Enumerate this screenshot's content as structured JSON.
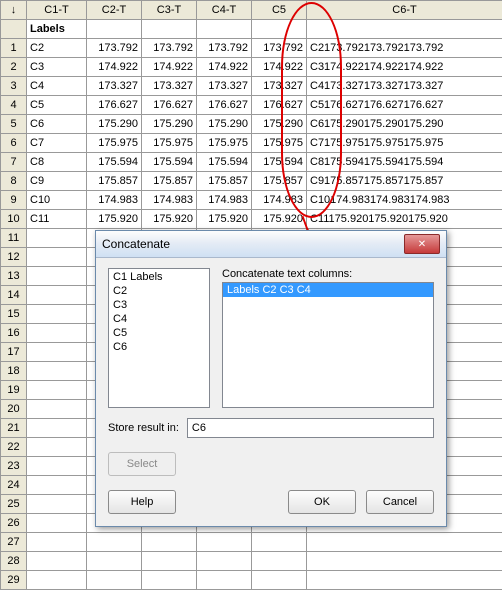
{
  "chart_data": {
    "type": "table",
    "columns": [
      "Labels",
      "C2-T",
      "C3-T",
      "C4-T",
      "C5",
      "C6-T"
    ],
    "rows": [
      [
        "C2",
        173.792,
        173.792,
        173.792,
        173.792,
        "C2173.792173.792173.792"
      ],
      [
        "C3",
        174.922,
        174.922,
        174.922,
        174.922,
        "C3174.922174.922174.922"
      ],
      [
        "C4",
        173.327,
        173.327,
        173.327,
        173.327,
        "C4173.327173.327173.327"
      ],
      [
        "C5",
        176.627,
        176.627,
        176.627,
        176.627,
        "C5176.627176.627176.627"
      ],
      [
        "C6",
        175.29,
        175.29,
        175.29,
        175.29,
        "C6175.290175.290175.290"
      ],
      [
        "C7",
        175.975,
        175.975,
        175.975,
        175.975,
        "C7175.975175.975175.975"
      ],
      [
        "C8",
        175.594,
        175.594,
        175.594,
        175.594,
        "C8175.594175.594175.594"
      ],
      [
        "C9",
        175.857,
        175.857,
        175.857,
        175.857,
        "C9175.857175.857175.857"
      ],
      [
        "C10",
        174.983,
        174.983,
        174.983,
        174.983,
        "C10174.983174.983174.983"
      ],
      [
        "C11",
        175.92,
        175.92,
        175.92,
        175.92,
        "C11175.920175.920175.920"
      ]
    ]
  },
  "headers": {
    "arrow": "↓",
    "c1": "C1-T",
    "c2": "C2-T",
    "c3": "C3-T",
    "c4": "C4-T",
    "c5": "C5",
    "c6": "C6-T",
    "sub": "Labels"
  },
  "rows": [
    {
      "n": "1",
      "l": "C2",
      "a": "173.792",
      "b": "173.792",
      "c": "173.792",
      "d": "173.792",
      "e": "C2173.792173.792173.792"
    },
    {
      "n": "2",
      "l": "C3",
      "a": "174.922",
      "b": "174.922",
      "c": "174.922",
      "d": "174.922",
      "e": "C3174.922174.922174.922"
    },
    {
      "n": "3",
      "l": "C4",
      "a": "173.327",
      "b": "173.327",
      "c": "173.327",
      "d": "173.327",
      "e": "C4173.327173.327173.327"
    },
    {
      "n": "4",
      "l": "C5",
      "a": "176.627",
      "b": "176.627",
      "c": "176.627",
      "d": "176.627",
      "e": "C5176.627176.627176.627"
    },
    {
      "n": "5",
      "l": "C6",
      "a": "175.290",
      "b": "175.290",
      "c": "175.290",
      "d": "175.290",
      "e": "C6175.290175.290175.290"
    },
    {
      "n": "6",
      "l": "C7",
      "a": "175.975",
      "b": "175.975",
      "c": "175.975",
      "d": "175.975",
      "e": "C7175.975175.975175.975"
    },
    {
      "n": "7",
      "l": "C8",
      "a": "175.594",
      "b": "175.594",
      "c": "175.594",
      "d": "175.594",
      "e": "C8175.594175.594175.594"
    },
    {
      "n": "8",
      "l": "C9",
      "a": "175.857",
      "b": "175.857",
      "c": "175.857",
      "d": "175.857",
      "e": "C9175.857175.857175.857"
    },
    {
      "n": "9",
      "l": "C10",
      "a": "174.983",
      "b": "174.983",
      "c": "174.983",
      "d": "174.983",
      "e": "C10174.983174.983174.983"
    },
    {
      "n": "10",
      "l": "C11",
      "a": "175.920",
      "b": "175.920",
      "c": "175.920",
      "d": "175.920",
      "e": "C11175.920175.920175.920"
    }
  ],
  "blankRows": [
    "11",
    "12",
    "13",
    "14",
    "15",
    "16",
    "17",
    "18",
    "19",
    "20",
    "21",
    "22",
    "23",
    "24",
    "25",
    "26",
    "27",
    "28",
    "29"
  ],
  "dialog": {
    "title": "Concatenate",
    "close": "✕",
    "available": [
      {
        "c": "C1",
        "n": "Labels"
      },
      {
        "c": "C2",
        "n": ""
      },
      {
        "c": "C3",
        "n": ""
      },
      {
        "c": "C4",
        "n": ""
      },
      {
        "c": "C5",
        "n": ""
      },
      {
        "c": "C6",
        "n": ""
      }
    ],
    "concat_label": "Concatenate text columns:",
    "selected": "Labels C2 C3 C4",
    "store_label": "Store result in:",
    "store_value": "C6",
    "btn_select": "Select",
    "btn_help": "Help",
    "btn_ok": "OK",
    "btn_cancel": "Cancel"
  }
}
